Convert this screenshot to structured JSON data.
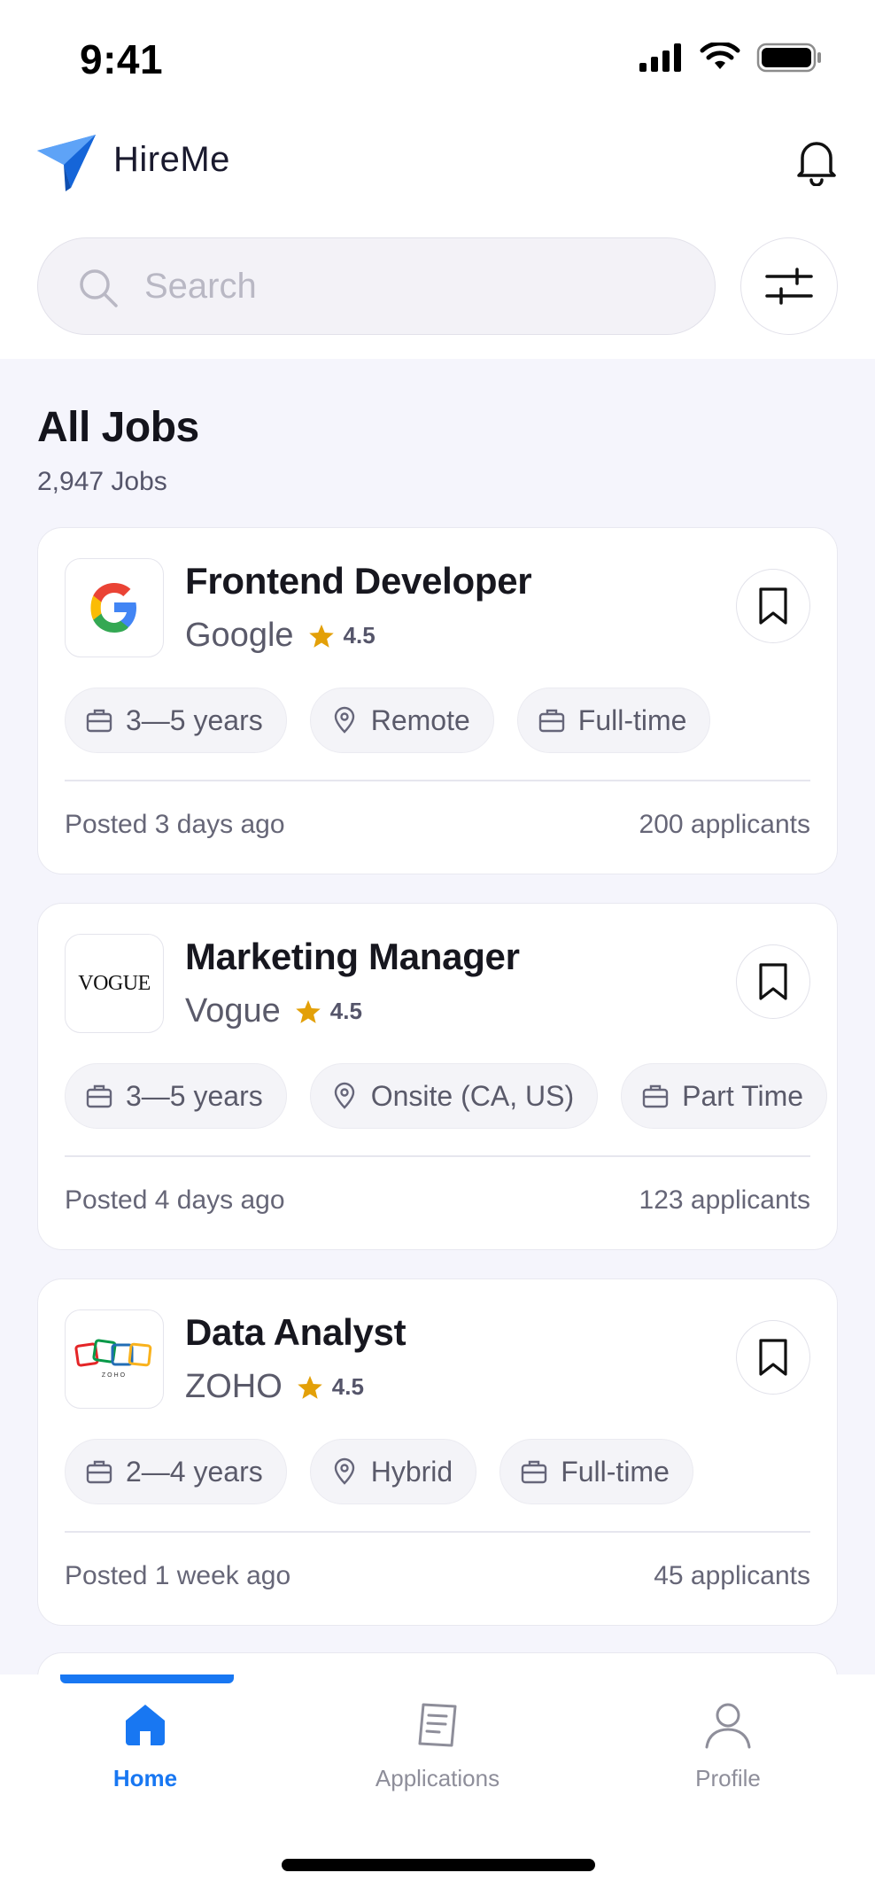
{
  "status_bar": {
    "time": "9:41"
  },
  "header": {
    "app_name": "HireMe",
    "brand_color": "#1877f2"
  },
  "search": {
    "placeholder": "Search",
    "value": ""
  },
  "section": {
    "title": "All Jobs",
    "count": "2,947 Jobs"
  },
  "jobs": [
    {
      "title": "Frontend Developer",
      "company": "Google",
      "rating": "4.5",
      "logo": "google-logo",
      "tags": [
        {
          "icon": "briefcase-icon",
          "label": "3—5 years"
        },
        {
          "icon": "location-pin-icon",
          "label": "Remote"
        },
        {
          "icon": "briefcase-icon",
          "label": "Full-time"
        }
      ],
      "posted": "Posted 3 days ago",
      "applicants": "200 applicants"
    },
    {
      "title": "Marketing Manager",
      "company": "Vogue",
      "rating": "4.5",
      "logo": "vogue-logo",
      "logo_text": "VOGUE",
      "tags": [
        {
          "icon": "briefcase-icon",
          "label": "3—5 years"
        },
        {
          "icon": "location-pin-icon",
          "label": "Onsite (CA, US)"
        },
        {
          "icon": "briefcase-icon",
          "label": "Part Time"
        }
      ],
      "posted": "Posted 4 days ago",
      "applicants": "123 applicants"
    },
    {
      "title": "Data Analyst",
      "company": "ZOHO",
      "rating": "4.5",
      "logo": "zoho-logo",
      "logo_text": "ZOHO",
      "tags": [
        {
          "icon": "briefcase-icon",
          "label": "2—4 years"
        },
        {
          "icon": "location-pin-icon",
          "label": "Hybrid"
        },
        {
          "icon": "briefcase-icon",
          "label": "Full-time"
        }
      ],
      "posted": "Posted 1 week ago",
      "applicants": "45 applicants"
    }
  ],
  "nav": {
    "items": [
      {
        "label": "Home",
        "icon": "home-icon",
        "active": true
      },
      {
        "label": "Applications",
        "icon": "document-icon",
        "active": false
      },
      {
        "label": "Profile",
        "icon": "user-icon",
        "active": false
      }
    ]
  },
  "colors": {
    "star": "#e3a008",
    "accent": "#1877f2",
    "background": "#f5f5fc"
  }
}
